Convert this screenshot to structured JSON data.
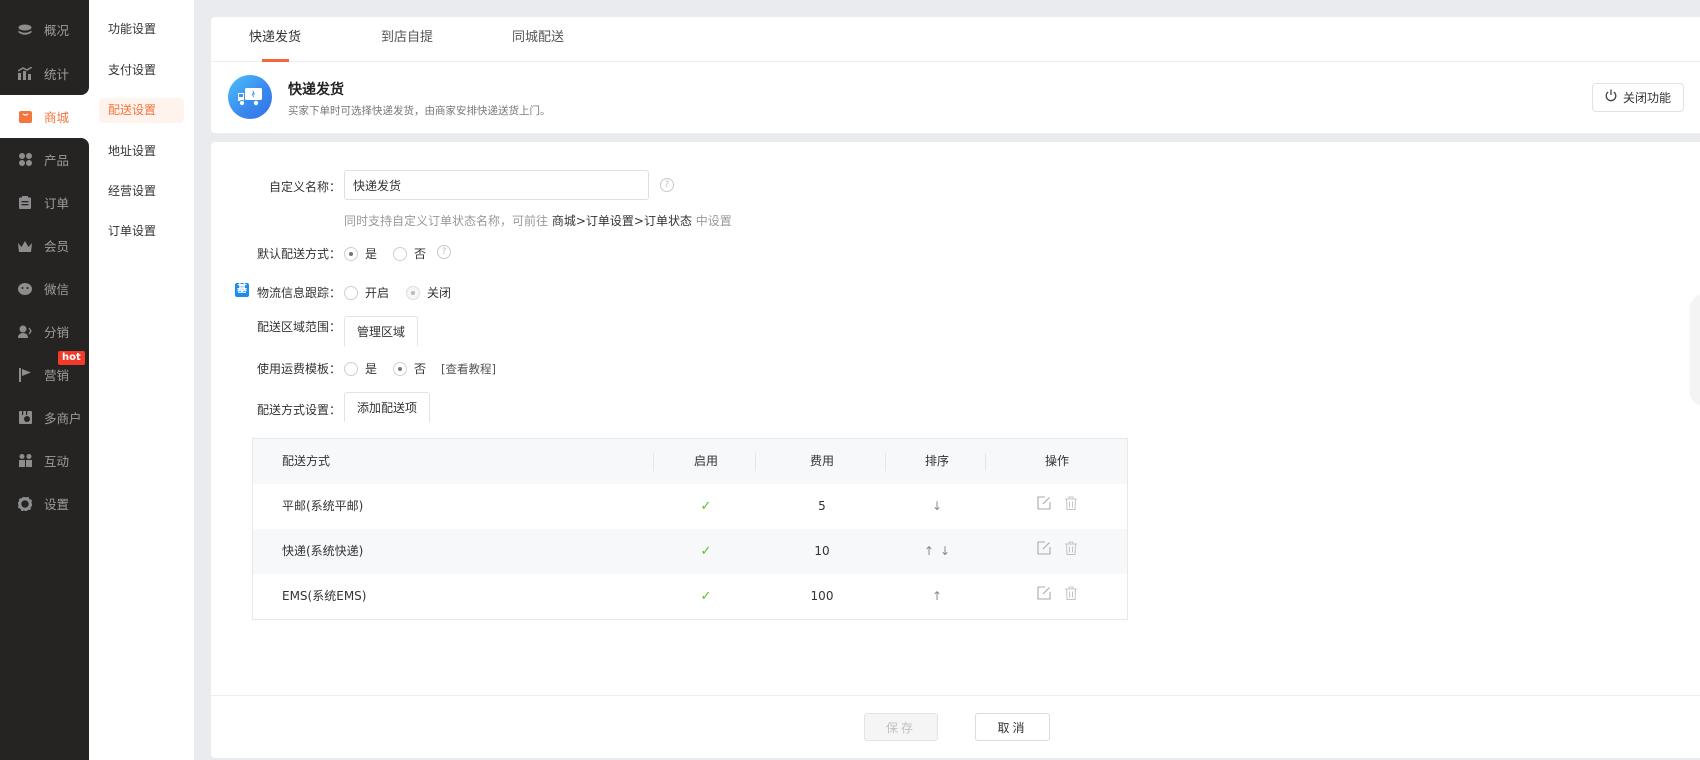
{
  "sidebar": {
    "items": [
      {
        "label": "概况",
        "icon": "layers-icon"
      },
      {
        "label": "统计",
        "icon": "bar-chart-icon"
      },
      {
        "label": "商城",
        "icon": "shopping-bag-icon",
        "active": true
      },
      {
        "label": "产品",
        "icon": "grid-icon"
      },
      {
        "label": "订单",
        "icon": "clipboard-icon"
      },
      {
        "label": "会员",
        "icon": "crown-icon"
      },
      {
        "label": "微信",
        "icon": "wechat-icon"
      },
      {
        "label": "分销",
        "icon": "user-share-icon"
      },
      {
        "label": "营销",
        "icon": "flag-icon",
        "badge": "hot"
      },
      {
        "label": "多商户",
        "icon": "store-icon"
      },
      {
        "label": "互动",
        "icon": "people-icon"
      },
      {
        "label": "设置",
        "icon": "gear-icon"
      }
    ]
  },
  "subnav": {
    "items": [
      {
        "label": "功能设置"
      },
      {
        "label": "支付设置"
      },
      {
        "label": "配送设置",
        "active": true
      },
      {
        "label": "地址设置"
      },
      {
        "label": "经营设置"
      },
      {
        "label": "订单设置"
      }
    ]
  },
  "tabs": [
    {
      "label": "快递发货",
      "active": true
    },
    {
      "label": "到店自提"
    },
    {
      "label": "同城配送"
    }
  ],
  "hero": {
    "icon": "truck-icon",
    "title": "快递发货",
    "description": "买家下单时可选择快递发货，由商家安排快递送货上门。",
    "close_button": "关闭功能"
  },
  "form": {
    "custom_name": {
      "label": "自定义名称：",
      "value": "快递发货",
      "hint_prefix": "同时支持自定义订单状态名称，可前往",
      "hint_path": "商城>订单设置>订单状态",
      "hint_suffix": "中设置"
    },
    "default_method": {
      "label": "默认配送方式：",
      "options": [
        {
          "label": "是",
          "checked": true
        },
        {
          "label": "否",
          "checked": false
        }
      ]
    },
    "logistics_tracking": {
      "badge": "基",
      "label": "物流信息跟踪：",
      "options": [
        {
          "label": "开启",
          "checked": false
        },
        {
          "label": "关闭",
          "checked": true
        }
      ]
    },
    "delivery_area": {
      "label": "配送区域范围：",
      "button": "管理区域"
    },
    "freight_template": {
      "label": "使用运费模板：",
      "options": [
        {
          "label": "是",
          "checked": false
        },
        {
          "label": "否",
          "checked": true
        }
      ],
      "link": "[查看教程]"
    },
    "delivery_methods": {
      "label": "配送方式设置：",
      "button": "添加配送项"
    }
  },
  "table": {
    "columns": [
      "配送方式",
      "启用",
      "费用",
      "排序",
      "操作"
    ],
    "rows": [
      {
        "name": "平邮(系统平邮)",
        "enabled": true,
        "fee": "5",
        "sort": [
          "down"
        ]
      },
      {
        "name": "快递(系统快递)",
        "enabled": true,
        "fee": "10",
        "sort": [
          "up",
          "down"
        ]
      },
      {
        "name": "EMS(系统EMS)",
        "enabled": true,
        "fee": "100",
        "sort": [
          "up"
        ]
      }
    ]
  },
  "footer": {
    "save": "保存",
    "cancel": "取消"
  },
  "colors": {
    "accent": "#f5763c",
    "sidebar_bg": "#252423",
    "check": "#52c41a",
    "hot": "#f33b2c",
    "info_blue": "#1d8cf0"
  }
}
